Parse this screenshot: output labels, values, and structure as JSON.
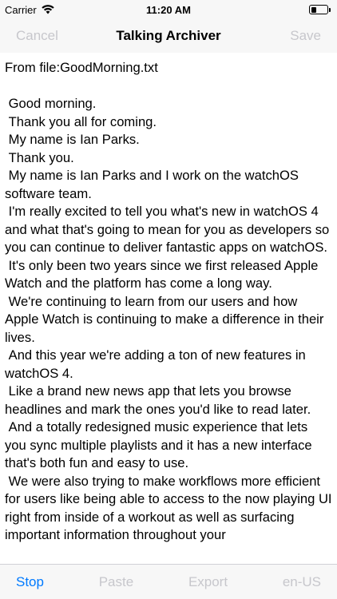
{
  "status_bar": {
    "carrier": "Carrier",
    "time": "11:20 AM",
    "battery_level": 0.35
  },
  "nav": {
    "cancel_label": "Cancel",
    "title": "Talking Archiver",
    "save_label": "Save"
  },
  "content": {
    "file_label": "From file:GoodMorning.txt",
    "paragraphs": [
      " Good morning.",
      " Thank you all for coming.",
      " My name is Ian Parks.",
      " Thank you.",
      " My name is Ian Parks and I work on the watchOS software team.",
      " I'm really excited to tell you what's new in watchOS 4 and what that's going to mean for you as developers so you can continue to deliver fantastic apps on watchOS.",
      " It's only been two years since we first released Apple Watch and the platform has come a long way.",
      " We're continuing to learn from our users and how Apple Watch is continuing to make a difference in their lives.",
      " And this year we're adding a ton of new features in watchOS 4.",
      " Like a brand new news app that lets you browse headlines and mark the ones you'd like to read later.",
      " And a totally redesigned music experience that lets you sync multiple playlists and it has a new interface that's both fun and easy to use.",
      " We were also trying to make workflows more efficient for users like being able to access to the now playing UI right from inside of a workout as well as surfacing important information throughout your"
    ]
  },
  "toolbar": {
    "stop_label": "Stop",
    "paste_label": "Paste",
    "export_label": "Export",
    "language_label": "en-US"
  },
  "colors": {
    "accent": "#007aff",
    "disabled": "#c7c7cc",
    "bar_background": "#f7f7f7"
  }
}
